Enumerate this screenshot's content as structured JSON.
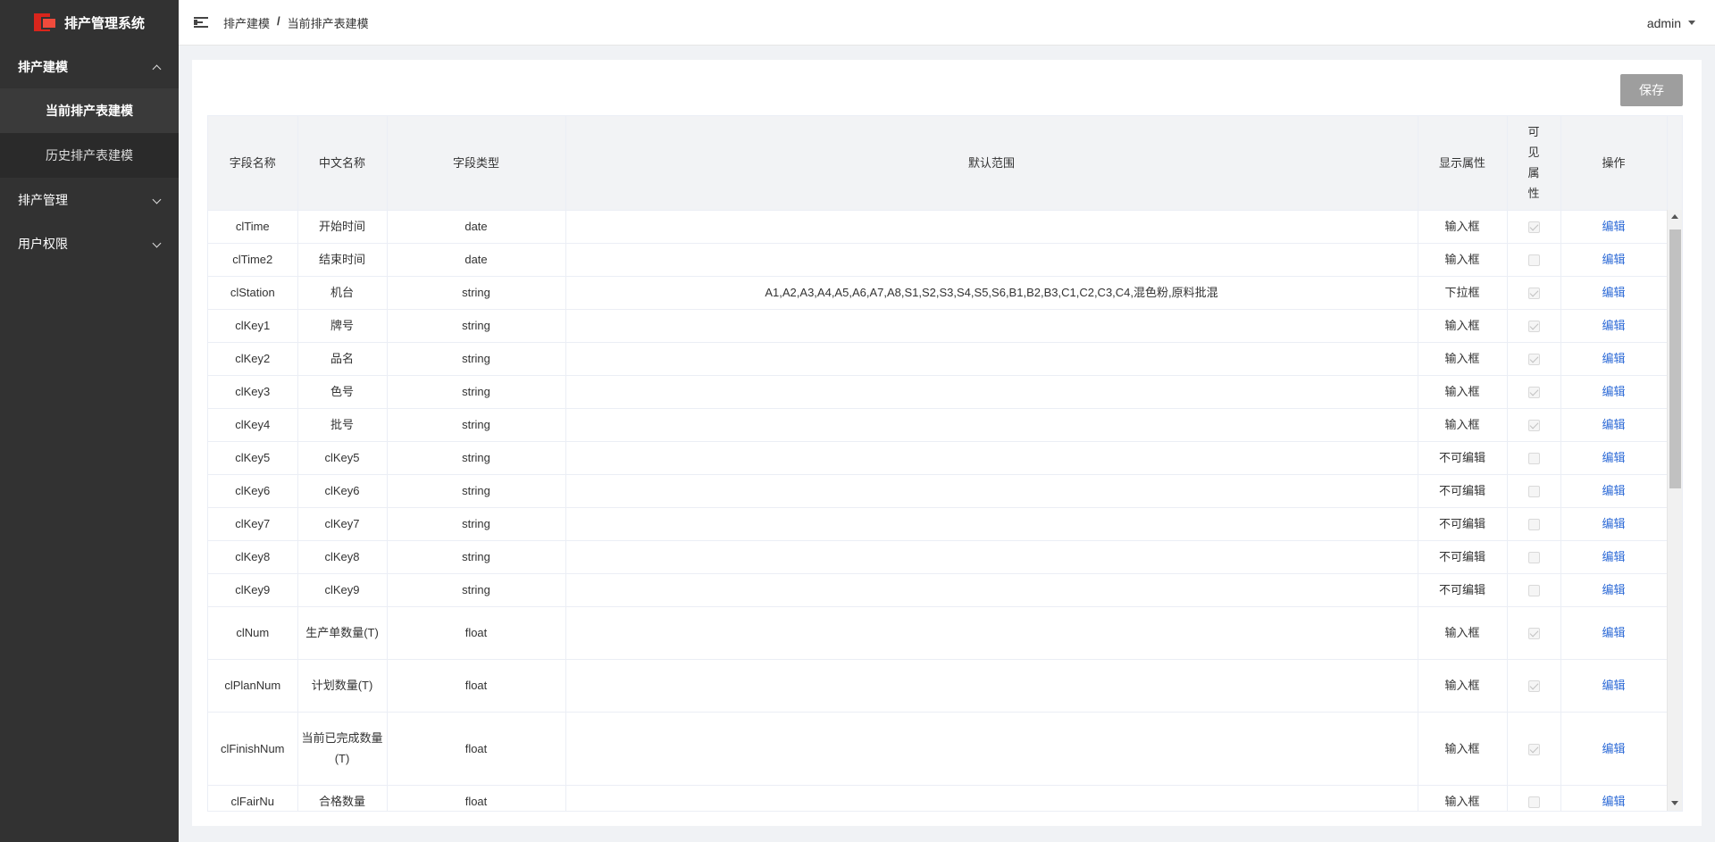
{
  "app": {
    "title": "排产管理系统",
    "logo_icon": "app-logo-icon"
  },
  "sidebar": {
    "groups": [
      {
        "label": "排产建模",
        "expanded": true,
        "items": [
          {
            "label": "当前排产表建模",
            "active": true
          },
          {
            "label": "历史排产表建模",
            "active": false
          }
        ]
      },
      {
        "label": "排产管理",
        "expanded": false
      },
      {
        "label": "用户权限",
        "expanded": false
      }
    ]
  },
  "header": {
    "breadcrumb": [
      "排产建模",
      "当前排产表建模"
    ],
    "separator": "/",
    "user": "admin"
  },
  "toolbar": {
    "save_label": "保存",
    "save_color": "#9e9e9e"
  },
  "table": {
    "columns": [
      "字段名称",
      "中文名称",
      "字段类型",
      "默认范围",
      "显示属性",
      "可见属性",
      "操作"
    ],
    "rows": [
      {
        "field": "clTime",
        "cn": "开始时间",
        "type": "date",
        "range": "",
        "display": "输入框",
        "visible": true,
        "action": "编辑"
      },
      {
        "field": "clTime2",
        "cn": "结束时间",
        "type": "date",
        "range": "",
        "display": "输入框",
        "visible": false,
        "action": "编辑"
      },
      {
        "field": "clStation",
        "cn": "机台",
        "type": "string",
        "range": "A1,A2,A3,A4,A5,A6,A7,A8,S1,S2,S3,S4,S5,S6,B1,B2,B3,C1,C2,C3,C4,混色粉,原料批混",
        "display": "下拉框",
        "visible": true,
        "action": "编辑"
      },
      {
        "field": "clKey1",
        "cn": "牌号",
        "type": "string",
        "range": "",
        "display": "输入框",
        "visible": true,
        "action": "编辑"
      },
      {
        "field": "clKey2",
        "cn": "品名",
        "type": "string",
        "range": "",
        "display": "输入框",
        "visible": true,
        "action": "编辑"
      },
      {
        "field": "clKey3",
        "cn": "色号",
        "type": "string",
        "range": "",
        "display": "输入框",
        "visible": true,
        "action": "编辑"
      },
      {
        "field": "clKey4",
        "cn": "批号",
        "type": "string",
        "range": "",
        "display": "输入框",
        "visible": true,
        "action": "编辑"
      },
      {
        "field": "clKey5",
        "cn": "clKey5",
        "type": "string",
        "range": "",
        "display": "不可编辑",
        "visible": false,
        "action": "编辑"
      },
      {
        "field": "clKey6",
        "cn": "clKey6",
        "type": "string",
        "range": "",
        "display": "不可编辑",
        "visible": false,
        "action": "编辑"
      },
      {
        "field": "clKey7",
        "cn": "clKey7",
        "type": "string",
        "range": "",
        "display": "不可编辑",
        "visible": false,
        "action": "编辑"
      },
      {
        "field": "clKey8",
        "cn": "clKey8",
        "type": "string",
        "range": "",
        "display": "不可编辑",
        "visible": false,
        "action": "编辑"
      },
      {
        "field": "clKey9",
        "cn": "clKey9",
        "type": "string",
        "range": "",
        "display": "不可编辑",
        "visible": false,
        "action": "编辑"
      },
      {
        "field": "clNum",
        "cn": "生产单数量(T)",
        "type": "float",
        "range": "",
        "display": "输入框",
        "visible": true,
        "action": "编辑"
      },
      {
        "field": "clPlanNum",
        "cn": "计划数量(T)",
        "type": "float",
        "range": "",
        "display": "输入框",
        "visible": true,
        "action": "编辑"
      },
      {
        "field": "clFinishNum",
        "cn": "当前已完成数量(T)",
        "type": "float",
        "range": "",
        "display": "输入框",
        "visible": true,
        "action": "编辑"
      },
      {
        "field": "clFairNu",
        "cn": "合格数量",
        "type": "float",
        "range": "",
        "display": "输入框",
        "visible": false,
        "action": "编辑"
      }
    ]
  }
}
